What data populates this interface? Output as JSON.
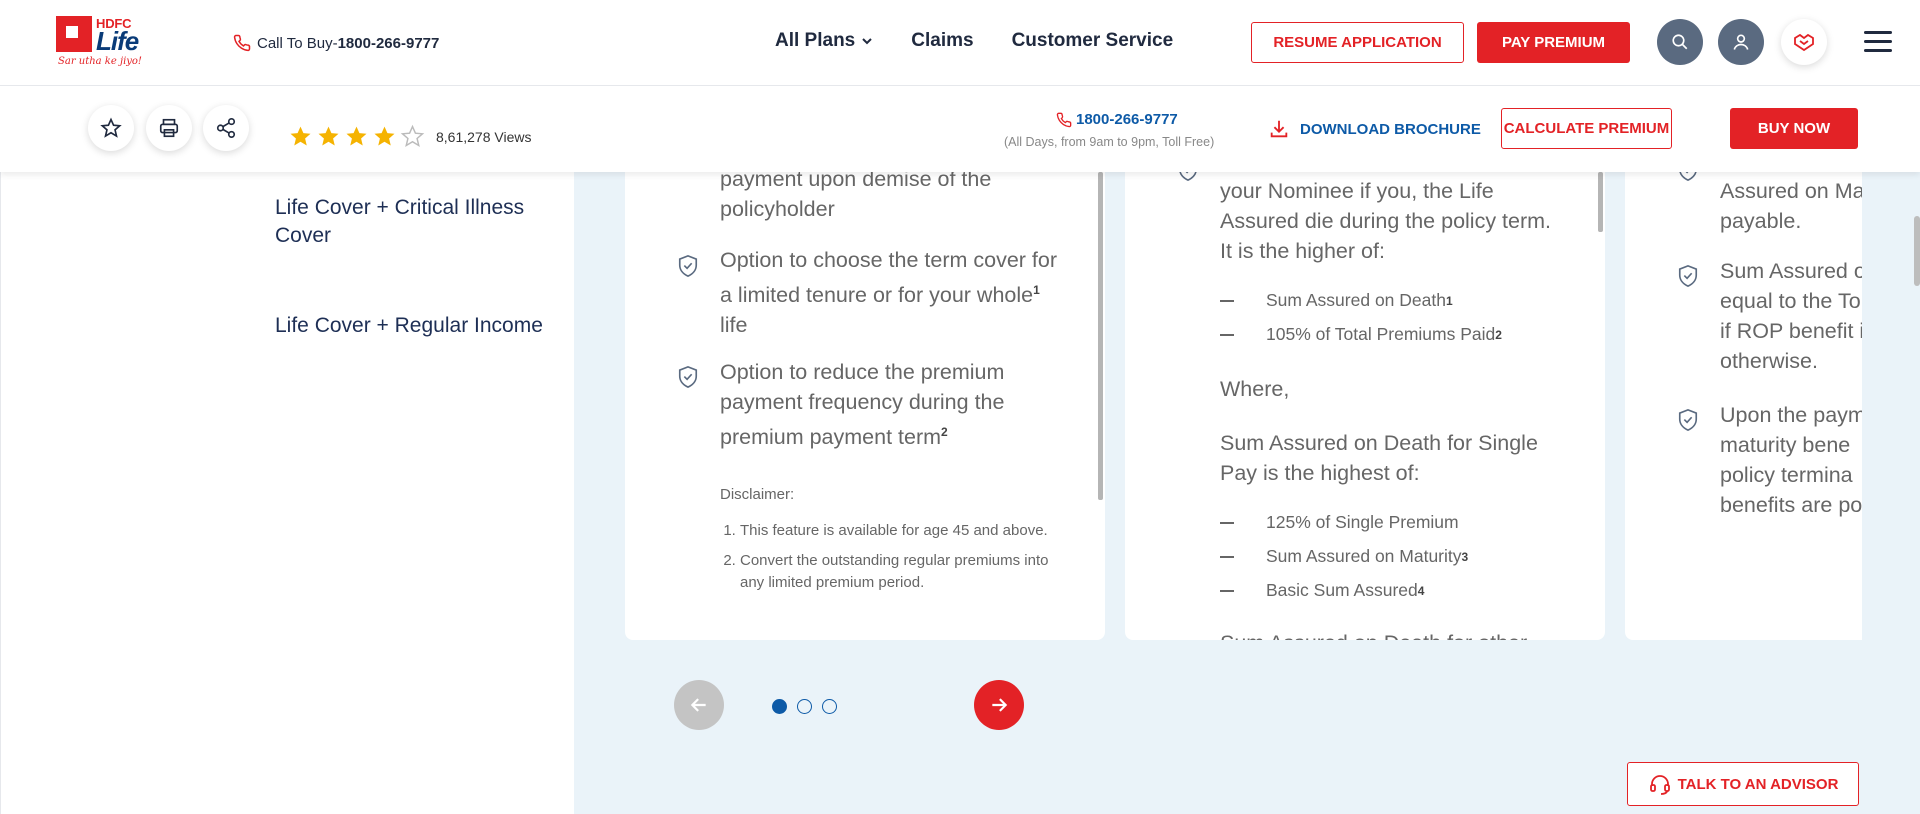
{
  "header": {
    "logo": {
      "brand": "HDFC",
      "product": "Life",
      "tagline": "Sar utha ke jiyo!"
    },
    "call_label": "Call To Buy-",
    "call_number": "1800-266-9777",
    "nav": [
      "All Plans",
      "Claims",
      "Customer Service"
    ],
    "resume_label": "RESUME APPLICATION",
    "pay_label": "PAY PREMIUM"
  },
  "subheader": {
    "rating": 4,
    "views": "8,61,278 Views",
    "phone": "1800-266-9777",
    "hours": "(All Days, from 9am to 9pm, Toll Free)",
    "download_label": "DOWNLOAD BROCHURE",
    "calculate_label": "CALCULATE PREMIUM",
    "buy_label": "BUY NOW"
  },
  "sidebar": {
    "items": [
      "Life Cover + Critical Illness Cover",
      "Life Cover + Regular Income"
    ]
  },
  "cards": {
    "card1": {
      "f0": "payment upon demise of the policyholder",
      "f1": "Option to choose the term cover for a limited tenure or for your whole",
      "f1_sup": "1",
      "f1_tail": " life",
      "f2": "Option to reduce the premium payment frequency during the premium payment term",
      "f2_sup": "2",
      "disclaimer_title": "Disclaimer:",
      "disclaimer_items": [
        "This feature is available for age 45 and above.",
        "Convert the outstanding regular premiums into any limited premium period."
      ]
    },
    "card2": {
      "p0": "your Nominee if you, the Life Assured die during the policy term. It is the higher of:",
      "d0": "Sum Assured on Death",
      "d0_sup": "1",
      "d1": "105% of Total Premiums Paid",
      "d1_sup": "2",
      "where": "Where,",
      "p1": "Sum Assured on Death for Single Pay is the highest of:",
      "d2": "125% of Single Premium",
      "d3": "Sum Assured on Maturity",
      "d3_sup": "3",
      "d4": "Basic Sum Assured",
      "d4_sup": "4",
      "cut": "Sum Assured on Death for other"
    },
    "card3": {
      "p0": "Assured on Ma payable.",
      "p1": "Sum Assured o equal to the To if ROP benefit i otherwise.",
      "p2": "Upon the paym maturity bene policy termina benefits are po"
    }
  },
  "advisor_label": "TALK TO AN ADVISOR",
  "colors": {
    "brand_red": "#e32226",
    "brand_blue": "#0d5aa7",
    "panel_bg": "#eaf3f9"
  }
}
